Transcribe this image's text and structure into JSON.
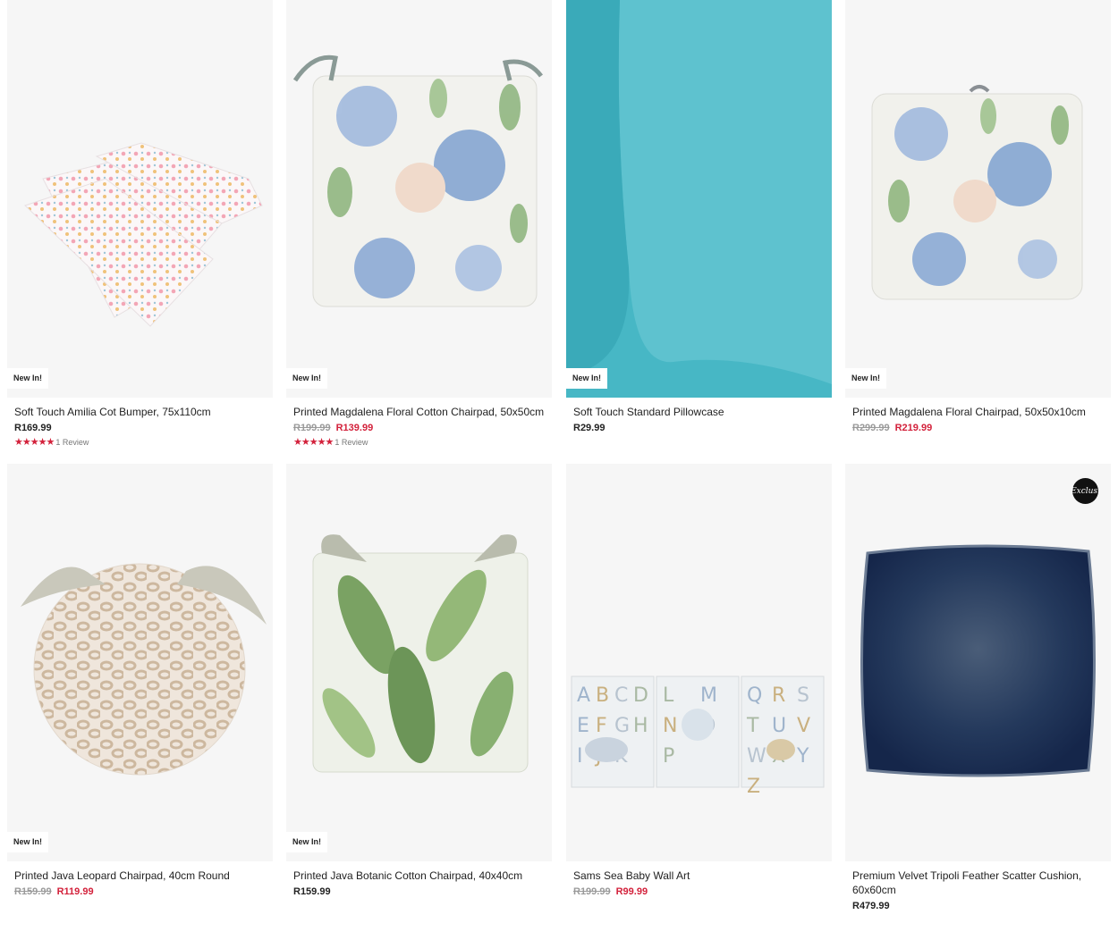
{
  "colors": {
    "sale": "#d3213b",
    "strike": "#9a9a9a",
    "text": "#222222",
    "tile_bg": "#f6f6f6"
  },
  "products": [
    {
      "name": "Soft Touch Amilia Cot Bumper, 75x110cm",
      "badge": "New In!",
      "price": "R169.99",
      "rating_stars": "★★★★★",
      "review_text": "1 Review",
      "image_icon": "cot-bumper-image"
    },
    {
      "name": "Printed Magdalena Floral Cotton Chairpad, 50x50cm",
      "badge": "New In!",
      "was_price": "R199.99",
      "price": "R139.99",
      "rating_stars": "★★★★★",
      "review_text": "1 Review",
      "image_icon": "floral-chairpad-image"
    },
    {
      "name": "Soft Touch Standard Pillowcase",
      "badge": "New In!",
      "price": "R29.99",
      "image_icon": "pillowcase-image"
    },
    {
      "name": "Printed Magdalena Floral Chairpad, 50x50x10cm",
      "badge": "New In!",
      "was_price": "R299.99",
      "price": "R219.99",
      "image_icon": "floral-box-chairpad-image"
    },
    {
      "name": "Printed Java Leopard Chairpad, 40cm Round",
      "badge": "New In!",
      "was_price": "R159.99",
      "price": "R119.99",
      "image_icon": "leopard-chairpad-image"
    },
    {
      "name": "Printed Java Botanic Cotton Chairpad, 40x40cm",
      "badge": "New In!",
      "price": "R159.99",
      "image_icon": "botanic-chairpad-image"
    },
    {
      "name": "Sams Sea Baby Wall Art",
      "was_price": "R199.99",
      "price": "R99.99",
      "image_icon": "wall-art-image",
      "wall_art_letters": [
        "A",
        "B",
        "C",
        "D",
        "E",
        "F",
        "G",
        "H",
        "I",
        "J",
        "K",
        "L",
        "M",
        "N",
        "O",
        "P",
        "Q",
        "R",
        "S",
        "T",
        "U",
        "V",
        "W",
        "X",
        "Y",
        "Z"
      ]
    },
    {
      "name": "Premium Velvet Tripoli Feather Scatter Cushion, 60x60cm",
      "price": "R479.99",
      "exclusive_logo_text": "Exclus.",
      "image_icon": "velvet-cushion-image"
    }
  ]
}
